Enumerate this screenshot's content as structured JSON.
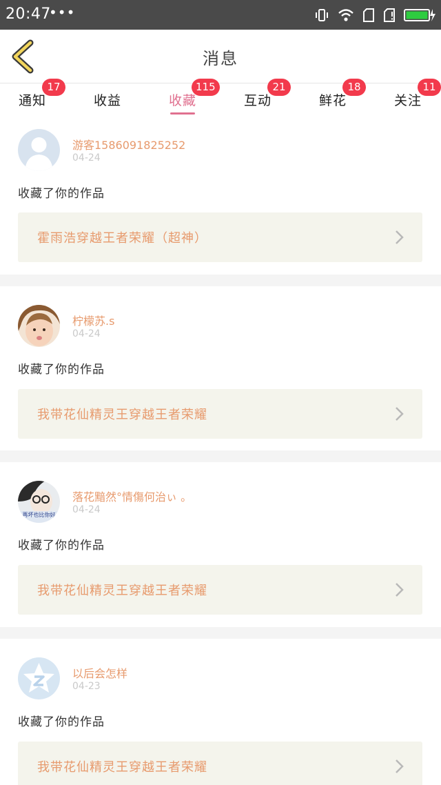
{
  "status_bar": {
    "time": "20:47",
    "more": "•••",
    "icons": [
      "vibrate-icon",
      "wifi-icon",
      "sim1-icon",
      "sim2-icon",
      "battery-charging-icon"
    ],
    "battery_color": "#2ecc40"
  },
  "header": {
    "back_icon": "chevron-left-icon",
    "title": "消息"
  },
  "tabs": [
    {
      "label": "通知",
      "badge": "17"
    },
    {
      "label": "收益",
      "badge": ""
    },
    {
      "label": "收藏",
      "badge": "115",
      "active": true
    },
    {
      "label": "互动",
      "badge": "21"
    },
    {
      "label": "鲜花",
      "badge": "18"
    },
    {
      "label": "关注",
      "badge": "11"
    }
  ],
  "accent_color": "#e0708f",
  "badge_color": "#f23a4c",
  "items": [
    {
      "user": "游客1586091825252",
      "date": "04-24",
      "action": "收藏了你的作品",
      "work": "霍雨浩穿越王者荣耀（超神）",
      "avatar": "default-user-avatar"
    },
    {
      "user": "柠檬苏.s",
      "date": "04-24",
      "action": "收藏了你的作品",
      "work": "我带花仙精灵王穿越王者荣耀",
      "avatar": "child-photo-avatar"
    },
    {
      "user": "落花黯然°情傷何治ぃ 。",
      "date": "04-24",
      "action": "收藏了你的作品",
      "work": "我带花仙精灵王穿越王者荣耀",
      "avatar": "girl-glasses-avatar",
      "avatar_caption": "再坏也比你好"
    },
    {
      "user": "以后会怎样",
      "date": "04-23",
      "action": "收藏了你的作品",
      "work": "我带花仙精灵王穿越王者荣耀",
      "avatar": "qq-star-avatar"
    }
  ]
}
